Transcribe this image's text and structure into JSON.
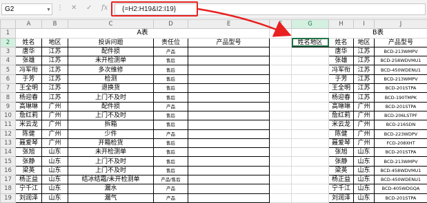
{
  "formula_bar": {
    "name_box": "G2",
    "cancel_icon": "✕",
    "enter_icon": "✓",
    "fx_label": "fx",
    "formula": "{=H2:H19&I2:I19}"
  },
  "columns": [
    "A",
    "B",
    "C",
    "D",
    "E",
    "F",
    "G",
    "H",
    "I",
    "J"
  ],
  "rows": [
    [
      "1",
      "",
      "",
      "A表",
      "",
      "",
      "",
      "",
      "",
      "B表",
      ""
    ],
    [
      "2",
      "姓名",
      "地区",
      "投诉问题",
      "责任位",
      "产品型号",
      "",
      "姓名地区",
      "姓名",
      "地区",
      "产品型号"
    ],
    [
      "3",
      "唐华",
      "江苏",
      "配件损",
      "产品",
      "",
      "",
      "",
      "唐华",
      "江苏",
      "BCD-213WMPV"
    ],
    [
      "4",
      "张雄",
      "江苏",
      "未开检测单",
      "售后",
      "",
      "",
      "",
      "张雄",
      "江苏",
      "BCD-258WDVMU1"
    ],
    [
      "5",
      "冯军衔",
      "江苏",
      "多次维修",
      "售后",
      "",
      "",
      "",
      "冯军衔",
      "江苏",
      "BCD-450WDENU1"
    ],
    [
      "6",
      "于芳",
      "江苏",
      "检测",
      "售后",
      "",
      "",
      "",
      "于芳",
      "江苏",
      "BCD-213WMPV"
    ],
    [
      "7",
      "王全明",
      "江苏",
      "退换货",
      "售后",
      "",
      "",
      "",
      "王全明",
      "江苏",
      "BCD-201STPA"
    ],
    [
      "8",
      "杨迎春",
      "江苏",
      "上门不及时",
      "售后",
      "",
      "",
      "",
      "杨迎春",
      "江苏",
      "BCD-190TMPK"
    ],
    [
      "9",
      "高琳琳",
      "广州",
      "配件损",
      "产品",
      "",
      "",
      "",
      "高琳琳",
      "广州",
      "BCD-201STPA"
    ],
    [
      "10",
      "詹红莉",
      "广州",
      "上门不及时",
      "售后",
      "",
      "",
      "",
      "詹红莉",
      "广州",
      "BCD-206LSTPF"
    ],
    [
      "11",
      "米云龙",
      "广州",
      "拆箱",
      "售后",
      "",
      "",
      "",
      "米云龙",
      "广州",
      "BCD-216SDN"
    ],
    [
      "12",
      "陈健",
      "广州",
      "少件",
      "产品",
      "",
      "",
      "",
      "陈健",
      "广州",
      "BCD-223WDPV"
    ],
    [
      "13",
      "聂爱琴",
      "广州",
      "开箱检货",
      "售后",
      "",
      "",
      "",
      "聂爱琴",
      "广州",
      "FCD-208XHT"
    ],
    [
      "14",
      "张旭",
      "山东",
      "未开检测单",
      "售后",
      "",
      "",
      "",
      "张旭",
      "山东",
      "BCD-201STPA"
    ],
    [
      "15",
      "张静",
      "山东",
      "上门不及时",
      "售后",
      "",
      "",
      "",
      "张静",
      "山东",
      "BCD-213WMPV"
    ],
    [
      "16",
      "梁英",
      "山东",
      "上门不及时",
      "售后",
      "",
      "",
      "",
      "梁英",
      "山东",
      "BCD-458WDVMU1"
    ],
    [
      "17",
      "杨正益",
      "山东",
      "结冰结霜/未开检测单",
      "产品/售后",
      "",
      "",
      "",
      "杨正益",
      "山东",
      "BCD-450WDENU1"
    ],
    [
      "18",
      "宁千江",
      "山东",
      "漏水",
      "产品",
      "",
      "",
      "",
      "宁千江",
      "山东",
      "BCD-405WDGQA"
    ],
    [
      "19",
      "刘润泽",
      "山东",
      "漏气",
      "产品",
      "",
      "",
      "",
      "刘润泽",
      "山东",
      "BCD-201STPA"
    ]
  ]
}
